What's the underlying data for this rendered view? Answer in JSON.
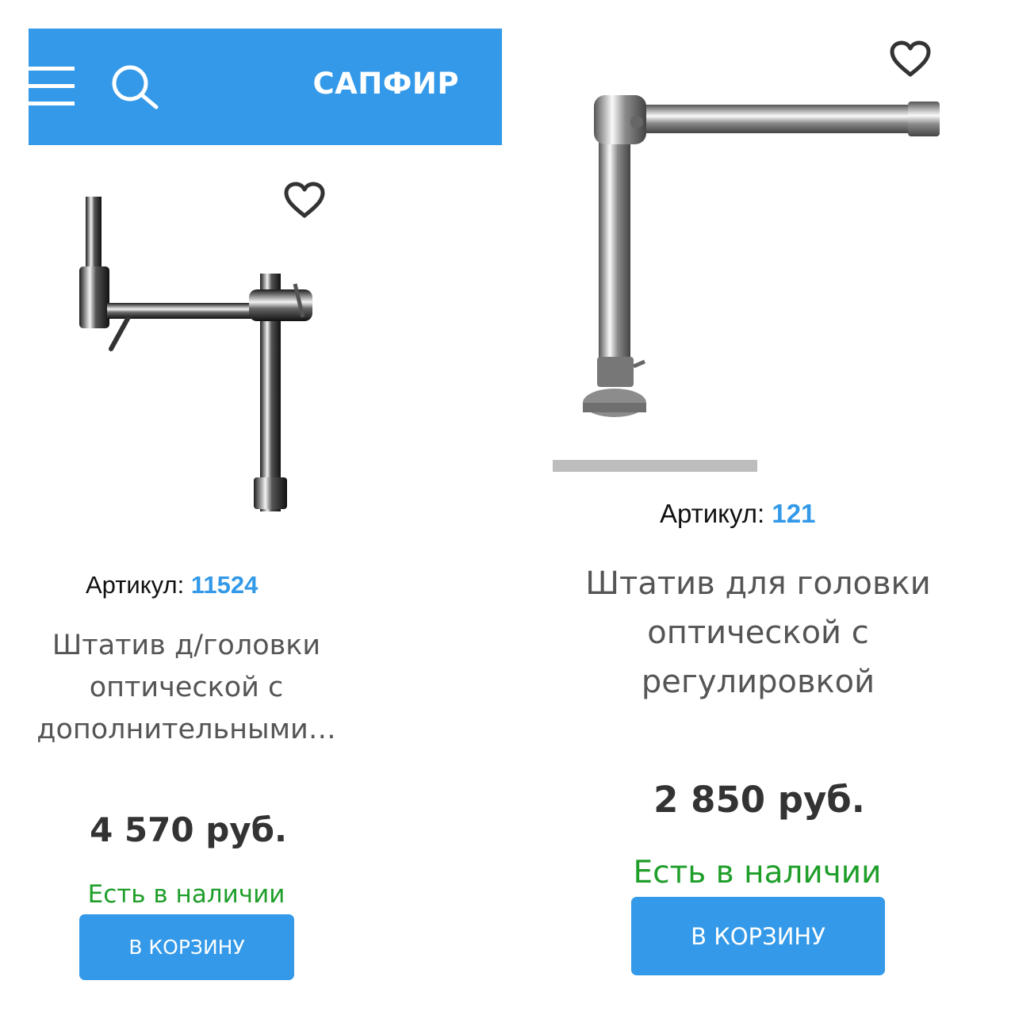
{
  "header": {
    "menu_icon": "hamburger-icon",
    "search_icon": "search-icon",
    "logo": "САПФИР",
    "color": "#3399e8"
  },
  "products": [
    {
      "favorite_icon": "heart-icon",
      "sku_label": "Артикул:",
      "sku": "11524",
      "title_lines": [
        "Штатив д/головки",
        "оптической с",
        "дополнительными…"
      ],
      "price": "4 570 руб.",
      "stock": "Есть в наличии",
      "button": "В КОРЗИНУ"
    },
    {
      "favorite_icon": "heart-icon",
      "sku_label": "Артикул:",
      "sku": "121",
      "title_lines": [
        "Штатив для головки",
        "оптической с",
        "регулировкой"
      ],
      "price": "2 850 руб.",
      "stock": "Есть в наличии",
      "button": "В КОРЗИНУ"
    }
  ],
  "colors": {
    "accent": "#3399e8",
    "stock": "#1f9e2a"
  }
}
